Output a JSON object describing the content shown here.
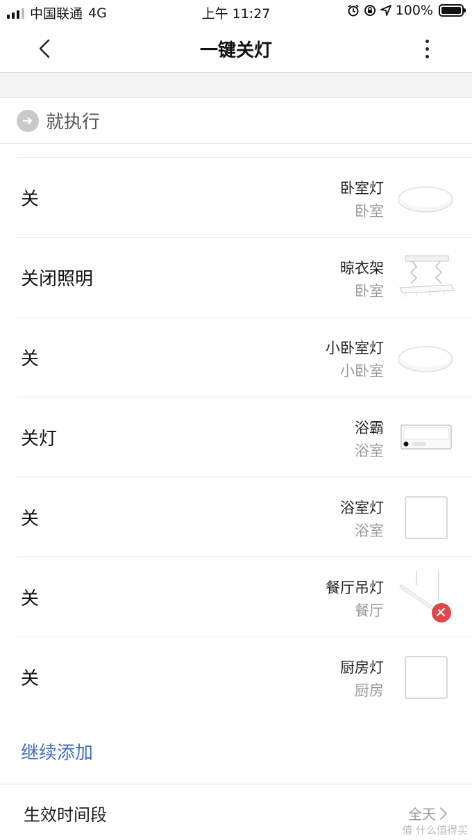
{
  "status_bar": {
    "carrier": "中国联通",
    "network": "4G",
    "time": "上午 11:27",
    "battery": "100%"
  },
  "nav": {
    "title": "一键关灯"
  },
  "exec_section": {
    "label": "就执行"
  },
  "actions": [
    {
      "action": "关",
      "device": "卧室灯",
      "room": "卧室",
      "icon": "ceiling-light-round"
    },
    {
      "action": "关闭照明",
      "device": "晾衣架",
      "room": "卧室",
      "icon": "drying-rack"
    },
    {
      "action": "关",
      "device": "小卧室灯",
      "room": "小卧室",
      "icon": "ceiling-light-round"
    },
    {
      "action": "关灯",
      "device": "浴霸",
      "room": "浴室",
      "icon": "bath-heater"
    },
    {
      "action": "关",
      "device": "浴室灯",
      "room": "浴室",
      "icon": "ceiling-light-square"
    },
    {
      "action": "关",
      "device": "餐厅吊灯",
      "room": "餐厅",
      "icon": "pendant-light-offline"
    },
    {
      "action": "关",
      "device": "厨房灯",
      "room": "厨房",
      "icon": "ceiling-light-square"
    }
  ],
  "continue_add": "继续添加",
  "effective_time": {
    "label": "生效时间段",
    "value": "全天"
  },
  "watermark": "值 什么值得买",
  "colors": {
    "accent_blue": "#3f6fc2",
    "offline_badge": "#e04848"
  }
}
